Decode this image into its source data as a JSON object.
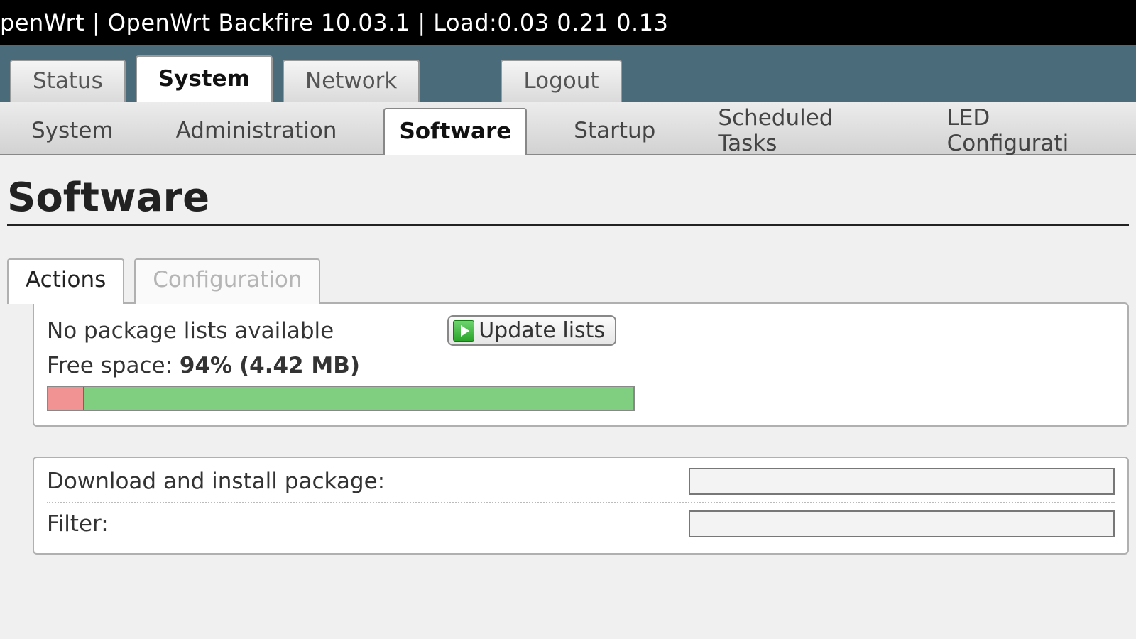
{
  "topbar": {
    "left_fragment": "penWrt",
    "sep": " | ",
    "firmware": "OpenWrt Backfire 10.03.1",
    "load_label": "Load:",
    "load": "0.03 0.21 0.13"
  },
  "nav": {
    "tabs": [
      {
        "label": "Status",
        "active": false
      },
      {
        "label": "System",
        "active": true
      },
      {
        "label": "Network",
        "active": false
      },
      {
        "label": "Logout",
        "active": false,
        "separated": true
      }
    ]
  },
  "subnav": {
    "items": [
      {
        "label": "System",
        "active": false
      },
      {
        "label": "Administration",
        "active": false
      },
      {
        "label": "Software",
        "active": true
      },
      {
        "label": "Startup",
        "active": false
      },
      {
        "label": "Scheduled Tasks",
        "active": false
      },
      {
        "label": "LED Configurati",
        "active": false
      }
    ]
  },
  "page": {
    "title": "Software"
  },
  "section_tabs": {
    "items": [
      {
        "label": "Actions",
        "active": true
      },
      {
        "label": "Configuration",
        "active": false
      }
    ]
  },
  "status_panel": {
    "msg": "No package lists available",
    "update_btn": "Update lists",
    "free_label": "Free space: ",
    "free_percent": "94%",
    "free_size": "4.42 MB",
    "used_pct": 6,
    "free_pct": 94
  },
  "forms": {
    "install_label": "Download and install package:",
    "install_value": "",
    "filter_label": "Filter:",
    "filter_value": ""
  }
}
